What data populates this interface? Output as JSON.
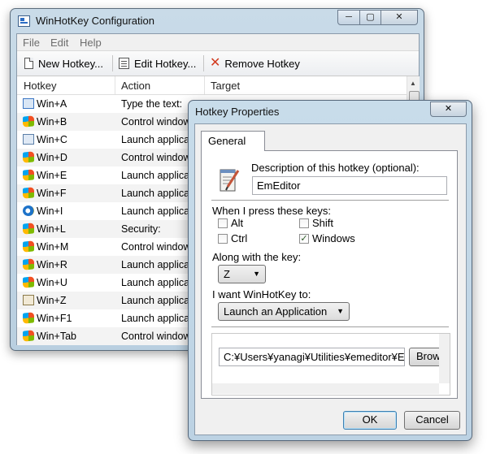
{
  "main_window": {
    "title": "WinHotKey Configuration",
    "caption": {
      "minimize": "─",
      "maximize": "▢",
      "close": "✕"
    },
    "menu": [
      "File",
      "Edit",
      "Help"
    ],
    "toolbar": {
      "new_hotkey": "New Hotkey...",
      "edit_hotkey": "Edit Hotkey...",
      "remove_hotkey": "Remove Hotkey"
    },
    "columns": [
      "Hotkey",
      "Action",
      "Target"
    ],
    "rows": [
      {
        "hotkey": "Win+A",
        "action": "Type the text:",
        "icon": "keyboard-icon"
      },
      {
        "hotkey": "Win+B",
        "action": "Control window",
        "icon": "windows-flag-icon"
      },
      {
        "hotkey": "Win+C",
        "action": "Launch application",
        "icon": "calculator-icon"
      },
      {
        "hotkey": "Win+D",
        "action": "Control window",
        "icon": "windows-flag-icon"
      },
      {
        "hotkey": "Win+E",
        "action": "Launch application",
        "icon": "windows-flag-icon"
      },
      {
        "hotkey": "Win+F",
        "action": "Launch application",
        "icon": "windows-flag-icon"
      },
      {
        "hotkey": "Win+I",
        "action": "Launch application",
        "icon": "internet-explorer-icon"
      },
      {
        "hotkey": "Win+L",
        "action": "Security:",
        "icon": "windows-flag-icon"
      },
      {
        "hotkey": "Win+M",
        "action": "Control window",
        "icon": "windows-flag-icon"
      },
      {
        "hotkey": "Win+R",
        "action": "Launch application",
        "icon": "windows-flag-icon"
      },
      {
        "hotkey": "Win+U",
        "action": "Launch application",
        "icon": "windows-flag-icon"
      },
      {
        "hotkey": "Win+Z",
        "action": "Launch application",
        "icon": "editor-pen-icon"
      },
      {
        "hotkey": "Win+F1",
        "action": "Launch application",
        "icon": "windows-flag-icon"
      },
      {
        "hotkey": "Win+Tab",
        "action": "Control window",
        "icon": "windows-flag-icon"
      }
    ]
  },
  "dialog": {
    "title": "Hotkey Properties",
    "close": "✕",
    "tab": "General",
    "description_label": "Description of this hotkey (optional):",
    "description_value": "EmEditor",
    "keys_label": "When I press these keys:",
    "modifiers": {
      "alt": {
        "label": "Alt",
        "checked": false
      },
      "shift": {
        "label": "Shift",
        "checked": false
      },
      "ctrl": {
        "label": "Ctrl",
        "checked": false
      },
      "windows": {
        "label": "Windows",
        "checked": true
      }
    },
    "key_label": "Along with the key:",
    "key_value": "Z",
    "action_label": "I want WinHotKey to:",
    "action_value": "Launch an Application",
    "path_value": "C:¥Users¥yanagi¥Utilities¥emeditor¥E",
    "browse": "Brow",
    "ok": "OK",
    "cancel": "Cancel"
  }
}
